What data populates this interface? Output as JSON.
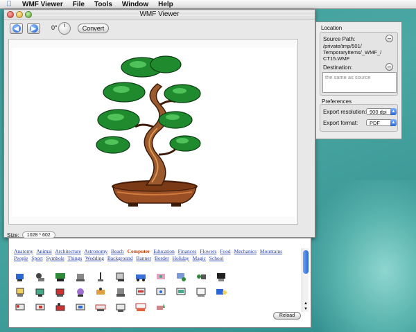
{
  "menubar": {
    "app_name": "WMF Viewer",
    "items": [
      "File",
      "Tools",
      "Window",
      "Help"
    ]
  },
  "window": {
    "title": "WMF Viewer",
    "rotation_label": "0°",
    "convert_label": "Convert",
    "size_label": "Size:",
    "size_value": "1028 * 602"
  },
  "inspector": {
    "location_header": "Location",
    "source_label": "Source Path:",
    "source_path": "/private/tmp/501/ TemporaryItems/_WMF_/ CT15.WMF",
    "destination_label": "Destination:",
    "destination_placeholder": "the same as source",
    "preferences_header": "Preferences",
    "resolution_label": "Export resolution:",
    "resolution_value": "900 dpi",
    "format_label": "Export format:",
    "format_value": "PDF"
  },
  "browser": {
    "categories": [
      "Anatomy",
      "Animal",
      "Architecture",
      "Astronomy",
      "Beach",
      "Computer",
      "Education",
      "Finances",
      "Flowers",
      "Food",
      "Mechanics",
      "Mountains",
      "People",
      "Sport",
      "Symbols",
      "Things",
      "Wedding",
      "Background",
      "Banner",
      "Border",
      "Holiday",
      "Magic",
      "School"
    ],
    "active_category": "Computer",
    "reload_label": "Reload"
  },
  "colors": {
    "desktop": "#3e9c9a",
    "link": "#2a3fa8",
    "active_link": "#c2410c",
    "foliage": "#1f8a2e",
    "trunk": "#8a4a22"
  },
  "icons": {
    "apple_menu": "apple-icon",
    "back": "arrow-left-icon",
    "forward": "arrow-right-icon",
    "rotate": "rotation-dial-icon",
    "remove": "minus-icon",
    "dropdown": "chevron-updown-icon"
  }
}
